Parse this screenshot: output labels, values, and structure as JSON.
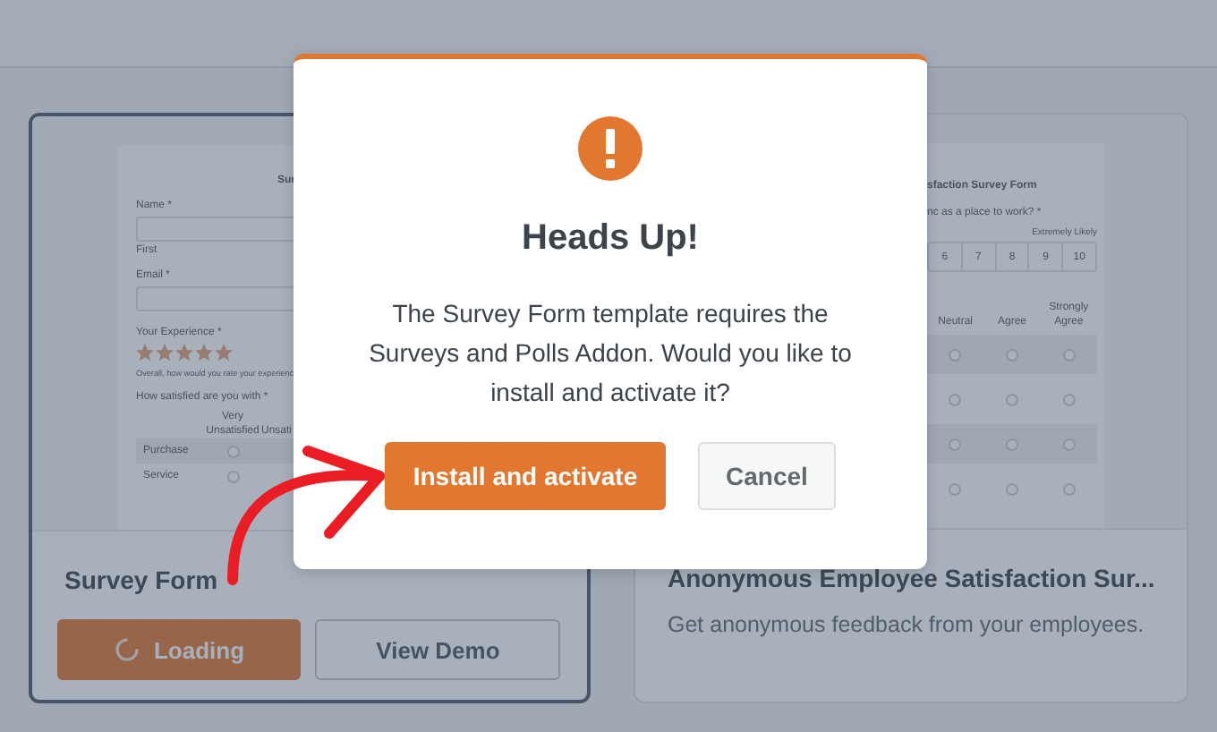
{
  "templates": [
    {
      "kind": "survey",
      "selected": true,
      "title": "Survey Form",
      "preview": {
        "heading": "Sur",
        "fields": [
          {
            "label": "Name *",
            "sublabel": "First"
          },
          {
            "label": "Email *"
          }
        ],
        "rating": {
          "label": "Your Experience *",
          "stars": 5,
          "hint": "Overall, how would you rate your experienc"
        },
        "matrix": {
          "label": "How satisfied are you with *",
          "columns": [
            "Very Unsatisfied",
            "Unsati"
          ],
          "rows": [
            {
              "label": "Purchase",
              "checked": false
            },
            {
              "label": "Service",
              "checked": false
            }
          ]
        }
      },
      "buttons": [
        {
          "label": "Loading",
          "kind": "loading"
        },
        {
          "label": "View Demo",
          "kind": "demo"
        }
      ]
    },
    {
      "kind": "employee",
      "selected": false,
      "title": "Anonymous Employee Satisfaction Sur...",
      "description": "Get anonymous feedback from your employees.",
      "preview": {
        "heading": "sfaction Survey Form",
        "question": "nc as a place to work? *",
        "scale_hint": "Extremely Likely",
        "scale": [
          "6",
          "7",
          "8",
          "9",
          "10"
        ],
        "columns": [
          "Neutral",
          "Agree",
          "Strongly Agree"
        ],
        "rows": [
          {
            "kind": "shaded",
            "options": [
              {
                "checked": false
              },
              {
                "checked": false
              },
              {
                "checked": false
              }
            ]
          },
          {
            "kind": "plain",
            "options": [
              {
                "checked": false
              },
              {
                "checked": false
              },
              {
                "checked": false
              }
            ]
          },
          {
            "kind": "shaded",
            "options": [
              {
                "checked": false
              },
              {
                "checked": false
              },
              {
                "checked": false
              }
            ]
          },
          {
            "kind": "plain",
            "options": [
              {
                "checked": false
              },
              {
                "checked": false
              },
              {
                "checked": false
              }
            ]
          }
        ]
      }
    }
  ],
  "modal": {
    "title": "Heads Up!",
    "message": "The Survey Form template requires the Surveys and Polls Addon. Would you like to install and activate it?",
    "buttons": [
      {
        "label": "Install and activate",
        "kind": "primary"
      },
      {
        "label": "Cancel",
        "kind": "secondary"
      }
    ]
  }
}
